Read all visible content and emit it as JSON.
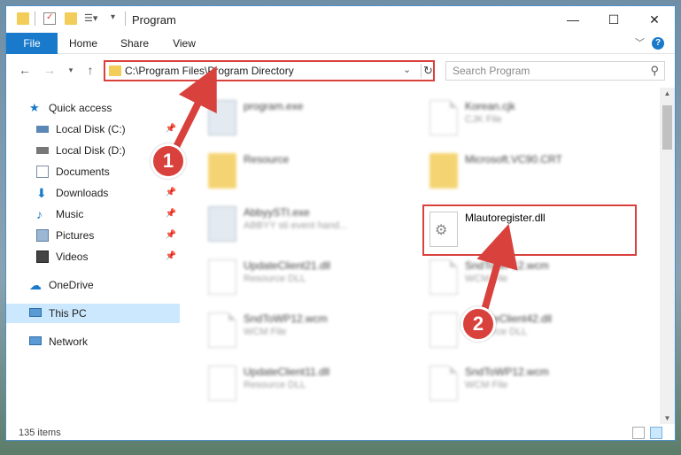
{
  "window": {
    "title": "Program"
  },
  "ribbon": {
    "tabs": [
      "File",
      "Home",
      "Share",
      "View"
    ],
    "help": "?"
  },
  "address": {
    "path": "C:\\Program Files\\Program Directory"
  },
  "search": {
    "placeholder": "Search Program"
  },
  "sidebar": {
    "items": [
      {
        "label": "Quick access",
        "icon": "star-icon"
      },
      {
        "label": "Local Disk (C:)",
        "icon": "disk-icon",
        "pinned": true
      },
      {
        "label": "Local Disk (D:)",
        "icon": "disk-icon",
        "pinned": true
      },
      {
        "label": "Documents",
        "icon": "documents-icon",
        "pinned": true
      },
      {
        "label": "Downloads",
        "icon": "download-icon",
        "pinned": true
      },
      {
        "label": "Music",
        "icon": "music-icon",
        "pinned": true
      },
      {
        "label": "Pictures",
        "icon": "pictures-icon",
        "pinned": true
      },
      {
        "label": "Videos",
        "icon": "videos-icon",
        "pinned": true
      },
      {
        "label": "OneDrive",
        "icon": "cloud-icon"
      },
      {
        "label": "This PC",
        "icon": "computer-icon",
        "selected": true
      },
      {
        "label": "Network",
        "icon": "network-icon"
      }
    ]
  },
  "files": [
    {
      "name": "program.exe",
      "desc": ""
    },
    {
      "name": "Korean.cjk",
      "desc": "CJK File"
    },
    {
      "name": "Resource",
      "desc": ""
    },
    {
      "name": "Microsoft.VC90.CRT",
      "desc": ""
    },
    {
      "name": "AbbyySTI.exe",
      "desc": "ABBYY sti event hand..."
    },
    {
      "name": "Mlautoregister.dll",
      "desc": ""
    },
    {
      "name": "UpdateClient21.dll",
      "desc": "Resource DLL"
    },
    {
      "name": "SndToWP12.wcm",
      "desc": "WCM File"
    },
    {
      "name": "SndToWP12.wcm",
      "desc": "WCM File"
    },
    {
      "name": "UpdateClient42.dll",
      "desc": "Resource DLL"
    },
    {
      "name": "UpdateClient11.dll",
      "desc": "Resource DLL"
    },
    {
      "name": "SndToWP12.wcm",
      "desc": "WCM File"
    }
  ],
  "status": {
    "count": "135 items"
  },
  "annotations": {
    "step1": "1",
    "step2": "2"
  },
  "colors": {
    "accent": "#1979ca",
    "highlight": "#d9413d",
    "folder": "#f3cd5a"
  }
}
